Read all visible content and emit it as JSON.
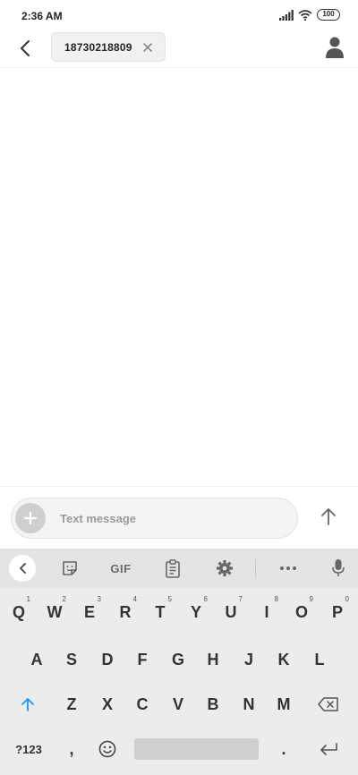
{
  "status_bar": {
    "time": "2:36 AM",
    "battery": "100",
    "icons": [
      "signal-icon",
      "wifi-icon",
      "battery-icon"
    ]
  },
  "header": {
    "back_icon": "chevron-left-icon",
    "recipient": "18730218809",
    "remove_icon": "close-icon",
    "contact_icon": "person-icon"
  },
  "compose": {
    "placeholder": "Text message",
    "attach_icon": "plus-icon",
    "send_icon": "arrow-up-icon"
  },
  "keyboard": {
    "toolbar": {
      "back_icon": "chevron-left-icon",
      "sticker_icon": "sticker-icon",
      "gif_label": "GIF",
      "clipboard_icon": "clipboard-icon",
      "settings_icon": "gear-icon",
      "more_icon": "more-dots-icon",
      "mic_icon": "mic-icon"
    },
    "row1": [
      {
        "label": "Q",
        "hint": "1"
      },
      {
        "label": "W",
        "hint": "2"
      },
      {
        "label": "E",
        "hint": "3"
      },
      {
        "label": "R",
        "hint": "4"
      },
      {
        "label": "T",
        "hint": "5"
      },
      {
        "label": "Y",
        "hint": "6"
      },
      {
        "label": "U",
        "hint": "7"
      },
      {
        "label": "I",
        "hint": "8"
      },
      {
        "label": "O",
        "hint": "9"
      },
      {
        "label": "P",
        "hint": "0"
      }
    ],
    "row2": [
      "A",
      "S",
      "D",
      "F",
      "G",
      "H",
      "J",
      "K",
      "L"
    ],
    "row3": [
      "Z",
      "X",
      "C",
      "V",
      "B",
      "N",
      "M"
    ],
    "row4": {
      "symbols_label": "?123",
      "comma_label": ",",
      "period_label": "."
    },
    "accent_color": "#2196f3"
  }
}
